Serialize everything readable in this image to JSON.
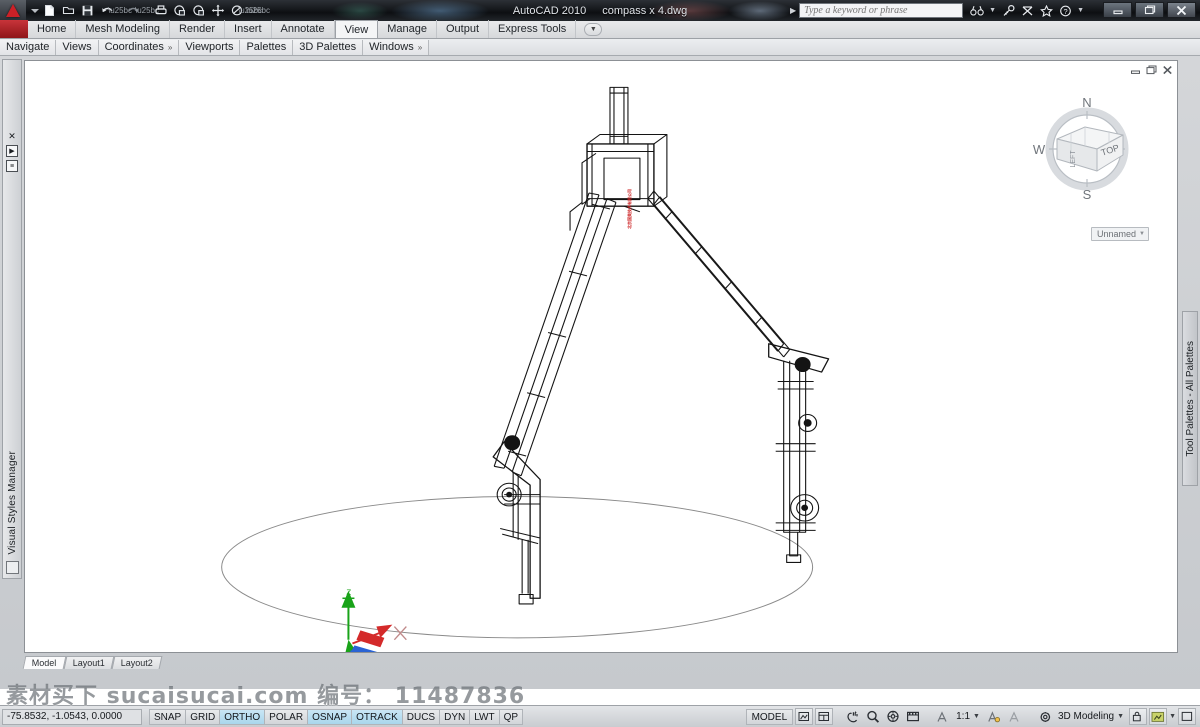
{
  "titlebar": {
    "app_name": "AutoCAD 2010",
    "document_name": "compass x 4.dwg",
    "quick_access": [
      {
        "name": "new-button",
        "label": "New"
      },
      {
        "name": "open-button",
        "label": "Open"
      },
      {
        "name": "save-button",
        "label": "Save"
      },
      {
        "name": "undo-button",
        "label": "Undo"
      },
      {
        "name": "redo-button",
        "label": "Redo"
      },
      {
        "name": "plot-button",
        "label": "Plot"
      },
      {
        "name": "plot-preview-button",
        "label": "Plot Preview"
      },
      {
        "name": "publish-button",
        "label": "Publish"
      },
      {
        "name": "pan-button",
        "label": "Pan"
      },
      {
        "name": "workspace-button",
        "label": "Workspace"
      }
    ],
    "search_placeholder": "Type a keyword or phrase",
    "search_value": "",
    "info_icons": [
      "search-icon",
      "key-icon",
      "signature-icon",
      "favorites-icon",
      "help-icon"
    ],
    "window_buttons": {
      "minimize": "–",
      "restore": "❐",
      "close": "✕"
    }
  },
  "ribbon": {
    "tabs": [
      {
        "label": "Home",
        "active": false
      },
      {
        "label": "Mesh Modeling",
        "active": false
      },
      {
        "label": "Render",
        "active": false
      },
      {
        "label": "Insert",
        "active": false
      },
      {
        "label": "Annotate",
        "active": false
      },
      {
        "label": "View",
        "active": true
      },
      {
        "label": "Manage",
        "active": false
      },
      {
        "label": "Output",
        "active": false
      },
      {
        "label": "Express Tools",
        "active": false
      }
    ],
    "panels": [
      {
        "label": "Navigate",
        "expandable": false
      },
      {
        "label": "Views",
        "expandable": false
      },
      {
        "label": "Coordinates",
        "expandable": true
      },
      {
        "label": "Viewports",
        "expandable": false
      },
      {
        "label": "Palettes",
        "expandable": false
      },
      {
        "label": "3D Palettes",
        "expandable": false
      },
      {
        "label": "Windows",
        "expandable": true
      }
    ],
    "expand_marker": "▼",
    "panel_marker": "»"
  },
  "left_dock": {
    "title": "Visual Styles Manager",
    "close_icon": "✕",
    "autohide_icon": "▶",
    "menu_icon": "≡"
  },
  "right_dock": {
    "title": "Tool Palettes - All Palettes"
  },
  "drawing": {
    "window_buttons": {
      "minimize": "–",
      "restore": "❐",
      "close": "✕"
    },
    "viewcube": {
      "north": "N",
      "west": "W",
      "south": "S",
      "top_face": "TOP",
      "left_face": "LEFT"
    },
    "named_view": "Unnamed",
    "named_view_caret": "▼",
    "ucs_axes": {
      "x": "X",
      "y": "Y",
      "z": "Z"
    },
    "model_label_text": "北京国美技术有限公司",
    "colors": {
      "background": "#ffffff",
      "model_line": "#141414",
      "ground_ellipse": "#8a8a8a",
      "ucs_x": "#d42a2a",
      "ucs_y": "#2a63d4",
      "ucs_z": "#19a319",
      "label_red": "#cc1f20"
    }
  },
  "layout_tabs": [
    {
      "label": "Model",
      "active": true
    },
    {
      "label": "Layout1",
      "active": false
    },
    {
      "label": "Layout2",
      "active": false
    }
  ],
  "statusbar": {
    "coordinates": "-75.8532, -1.0543, 0.0000",
    "toggles": [
      {
        "label": "SNAP",
        "on": false
      },
      {
        "label": "GRID",
        "on": false
      },
      {
        "label": "ORTHO",
        "on": true
      },
      {
        "label": "POLAR",
        "on": false
      },
      {
        "label": "OSNAP",
        "on": true
      },
      {
        "label": "OTRACK",
        "on": true
      },
      {
        "label": "DUCS",
        "on": false
      },
      {
        "label": "DYN",
        "on": false
      },
      {
        "label": "LWT",
        "on": false
      },
      {
        "label": "QP",
        "on": false
      }
    ],
    "space_label": "MODEL",
    "annotation_scale": "1:1",
    "workspace": "3D Modeling",
    "workspace_caret": "▼",
    "scale_caret": "▼",
    "right_icons": [
      "quick-view-layouts-icon",
      "quick-view-drawings-icon",
      "pan-icon",
      "zoom-icon",
      "steering-wheel-icon",
      "showmotion-icon",
      "annotation-visibility-icon",
      "autoscale-icon",
      "workspace-gear-icon",
      "toolbar-lock-icon",
      "application-status-icon",
      "clean-screen-icon"
    ]
  },
  "watermark": {
    "text": "素材买下 sucaisucai.com 编号： 11487836"
  }
}
